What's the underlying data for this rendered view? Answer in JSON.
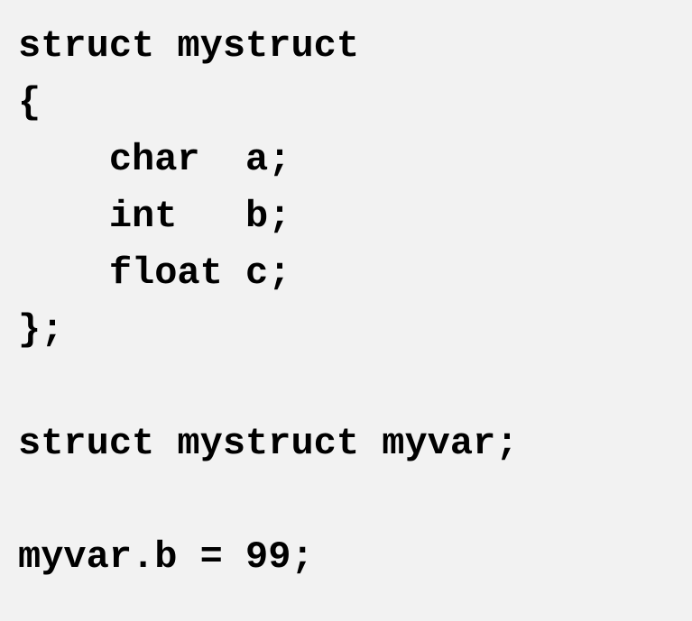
{
  "code": {
    "line1": "struct mystruct",
    "line2": "{",
    "line3": "    char  a;",
    "line4": "    int   b;",
    "line5": "    float c;",
    "line6": "};",
    "line7": "",
    "line8": "struct mystruct myvar;",
    "line9": "",
    "line10": "myvar.b = 99;"
  }
}
